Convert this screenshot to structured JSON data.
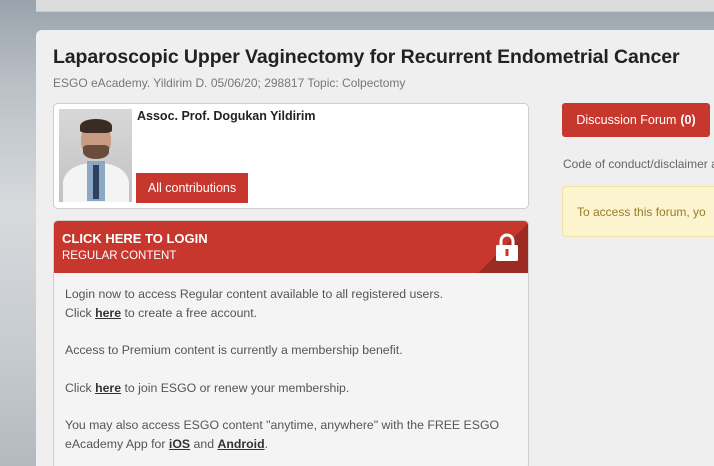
{
  "page": {
    "title": "Laparoscopic Upper Vaginectomy for Recurrent Endometrial Cancer",
    "subtitle": "ESGO eAcademy. Yildirim D. 05/06/20; 298817 Topic: Colpectomy"
  },
  "author": {
    "name": "Assoc. Prof. Dogukan Yildirim",
    "contributions_label": "All contributions"
  },
  "login": {
    "title": "CLICK HERE TO LOGIN",
    "subtitle": "REGULAR CONTENT",
    "icon": "lock-icon",
    "p1_text": "Login now to access Regular content available to all registered users.",
    "p1_click": "Click ",
    "p1_link": "here",
    "p1_after": " to create a free account.",
    "p2_text": "Access to Premium content is currently a membership benefit.",
    "p3_click": "Click ",
    "p3_link": "here",
    "p3_after": " to join ESGO or renew your membership.",
    "p4_text": "You may also access ESGO content \"anytime, anywhere\" with the FREE ESGO eAcademy App for ",
    "p4_ios": "iOS",
    "p4_and": " and ",
    "p4_android": "Android",
    "p4_end": "."
  },
  "forum": {
    "button_label": "Discussion Forum",
    "count": "(0)",
    "code_text": "Code of conduct/disclaimer a",
    "notice_text": "To access this forum, yo"
  },
  "colors": {
    "accent": "#c8372d",
    "notice_bg": "#fcf3cf",
    "notice_text": "#9b7b2a"
  }
}
